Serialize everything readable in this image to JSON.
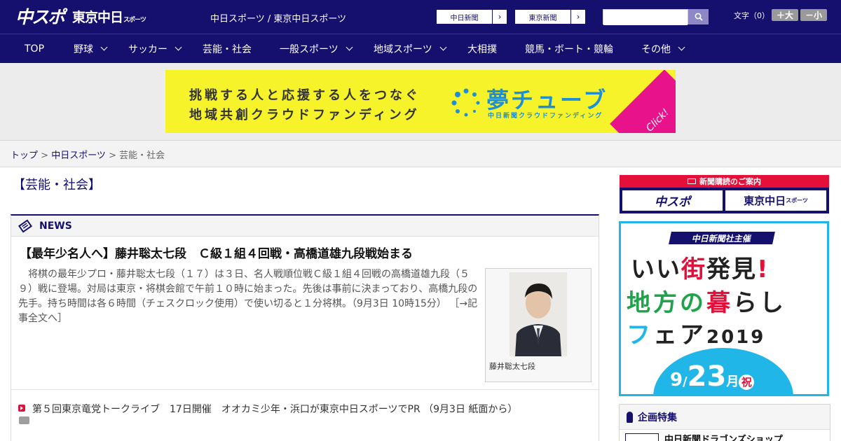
{
  "header": {
    "logo_main": "中スポ",
    "logo_tokyo": "東京中日",
    "logo_tokyo_small": "スポーツ",
    "site_title": "中日スポーツ / 東京中日スポーツ",
    "ext_links": [
      {
        "label": "中日新聞"
      },
      {
        "label": "東京新聞"
      }
    ],
    "search_placeholder": "",
    "font_size_label": "文字（0）",
    "font_up": "＋大",
    "font_down": "－小"
  },
  "nav": [
    {
      "label": "TOP",
      "dropdown": false
    },
    {
      "label": "野球",
      "dropdown": true
    },
    {
      "label": "サッカー",
      "dropdown": true
    },
    {
      "label": "芸能・社会",
      "dropdown": false
    },
    {
      "label": "一般スポーツ",
      "dropdown": true
    },
    {
      "label": "地域スポーツ",
      "dropdown": true
    },
    {
      "label": "大相撲",
      "dropdown": false
    },
    {
      "label": "競馬・ボート・競輪",
      "dropdown": false
    },
    {
      "label": "その他",
      "dropdown": true
    }
  ],
  "banner": {
    "line1": "挑戦する人と応援する人をつなぐ",
    "line2": "地域共創クラウドファンディング",
    "brand": "夢チューブ",
    "brand_sub": "中日新聞クラウドファンディング",
    "click": "Click!"
  },
  "breadcrumb": {
    "home": "トップ",
    "section": "中日スポーツ",
    "current": "芸能・社会"
  },
  "page_heading": "【芸能・社会】",
  "news": {
    "header": "NEWS",
    "lead": {
      "title": "【最年少名人へ】藤井聡太七段　Ｃ級１組４回戦・高橋道雄九段戦始まる",
      "body": "　将棋の最年少プロ・藤井聡太七段（１７）は３日、名人戦順位戦Ｃ級１組４回戦の高橋道雄九段（５９）戦に登場。対局は東京・将棋会館で午前１０時に始まった。先後は事前に決まっており、高橋九段の先手。持ち時間は各６時間（チェスクロック使用）で使い切ると１分将棋。（9月3日 10時15分）",
      "more": "［→記事全文へ］",
      "photo_caption": "藤井聡太七段"
    },
    "items": [
      {
        "text": "第５回東京竜党トークライブ　17日開催　オオカミ少年・浜口が東京中日スポーツでPR （9月3日 紙面から）"
      }
    ]
  },
  "sidebar": {
    "subscribe_title": "新聞購読のご案内",
    "subscribe_a": "中スポ",
    "subscribe_b": "東京中日",
    "subscribe_b_small": "スポーツ",
    "fair": {
      "host": "中日新聞社主催",
      "line1a": "いい",
      "line1b": "街",
      "line1c": "発見",
      "line1d": "!",
      "line2a": "地方の",
      "line2b": "暮",
      "line2c": "らし",
      "line3a": "フ",
      "line3b": "ェア",
      "line3c": "2019",
      "date_m": "9",
      "date_sep": "/",
      "date_d": "23",
      "date_w": "月",
      "date_h": "祝"
    },
    "feature_title": "企画特集",
    "feature_item": "中日新聞ドラゴンズショップ"
  },
  "colors": {
    "brand_navy": "#150f6e",
    "accent_red": "#e5103a",
    "banner_yellow": "#f6f32b",
    "fair_blue": "#21b6e8"
  }
}
